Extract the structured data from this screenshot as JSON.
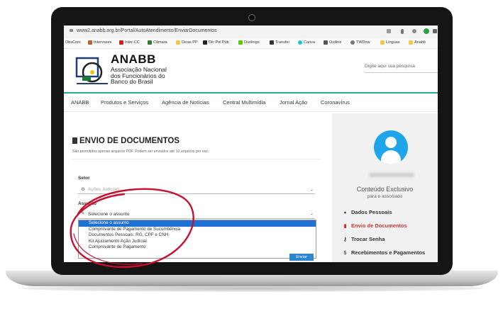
{
  "browser": {
    "url": "www2.anabb.org.br/Portal/AutoAtendimento/EnviarDocumentos",
    "bookmarks": [
      {
        "label": "ObsCom",
        "color": "#ffffff"
      },
      {
        "label": "Intervozes",
        "color": "#c0612b"
      },
      {
        "label": "Inter-CC",
        "color": "#d81b1b"
      },
      {
        "label": "Câmara",
        "color": "#2e7d32"
      },
      {
        "label": "Dicas PP",
        "color": "#f2c94c"
      },
      {
        "label": "Dic Pol Púb",
        "color": "#222222"
      },
      {
        "label": "Duolingo",
        "color": "#58cc02"
      },
      {
        "label": "Transfer",
        "color": "#333333"
      },
      {
        "label": "Canva",
        "color": "#20c4cb"
      },
      {
        "label": "Outline",
        "color": "#555555"
      },
      {
        "label": "TWDow",
        "color": "#777777"
      },
      {
        "label": "Línguas",
        "color": "#f2c94c"
      },
      {
        "label": "Anabb",
        "color": "#f2c94c"
      }
    ]
  },
  "site": {
    "brand": "ANABB",
    "brand_sub": "Associação Nacional dos Funcionários do Banco do Brasil",
    "search_placeholder": "Digite aqui sua pesquisa",
    "nav": [
      "ANABB",
      "Produtos e Serviços",
      "Agência de Notícias",
      "Central Multimídia",
      "Jornal Ação",
      "Coronavírus"
    ]
  },
  "form": {
    "title": "ENVIO DE DOCUMENTOS",
    "subtitle": "São permitidos apenas arquivos PDF. Podem ser enviados até 10 arquivos por vez.",
    "setor_label": "Setor",
    "setor_value": "Ações Judiciais",
    "assunto_label": "Assunto",
    "assunto_placeholder": "Selecione o assunto",
    "options": [
      "Selecione o assunto",
      "Comprovante de Pagamento de Sucumbência",
      "Documentos Pessoais: RG, CPF e CNH",
      "Kit Ajuizamento Ação Judicial",
      "Comprovante de Pagamento"
    ],
    "send_label": "Enviar"
  },
  "sidebar": {
    "exclusive_title": "Conteúdo Exclusivo",
    "exclusive_sub": "para o associado",
    "items": [
      {
        "label": "Dados Pessoais",
        "icon": "person-icon",
        "active": false
      },
      {
        "label": "Envio de Documentos",
        "icon": "document-icon",
        "active": true
      },
      {
        "label": "Trocar Senha",
        "icon": "key-icon",
        "active": false
      },
      {
        "label": "Recebimentos e Pagamentos",
        "icon": "dollar-icon",
        "active": false
      }
    ]
  },
  "colors": {
    "accent_teal": "#2aa8a0",
    "avatar_blue": "#1ea5ea",
    "active_red": "#d32f2f",
    "highlight_blue": "#1e72d6",
    "annotation_red": "#c8102e"
  }
}
